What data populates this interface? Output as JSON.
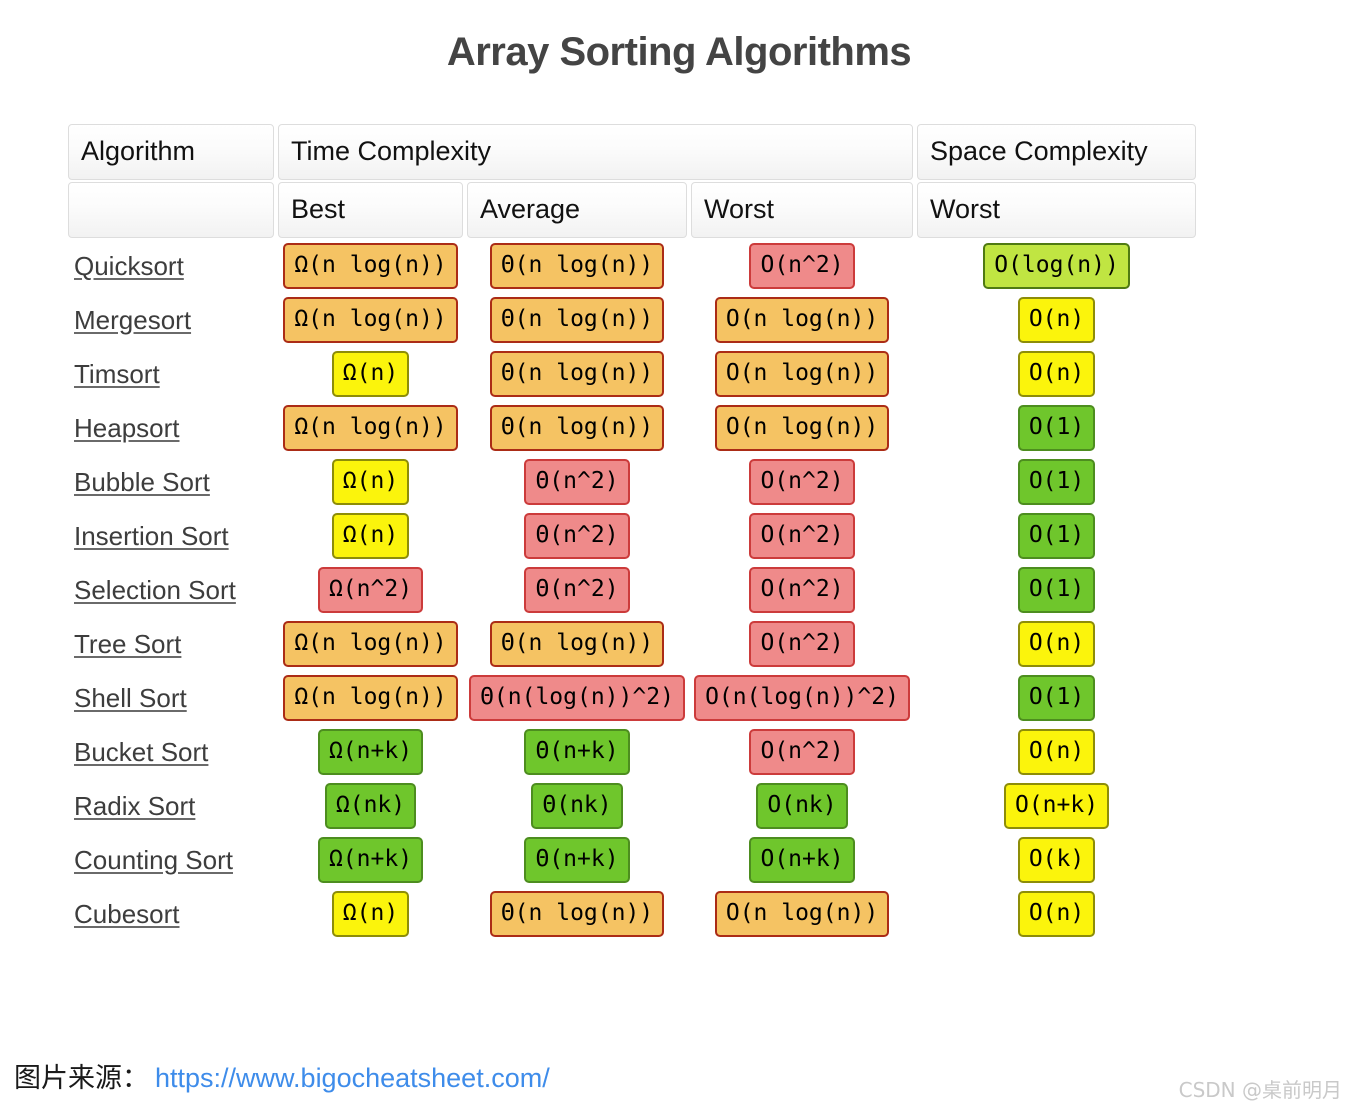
{
  "page": {
    "title": "Array Sorting Algorithms"
  },
  "table": {
    "group_headers": {
      "algorithm": "Algorithm",
      "time_complexity": "Time Complexity",
      "space_complexity": "Space Complexity"
    },
    "sub_headers": {
      "algorithm": "",
      "best": "Best",
      "average": "Average",
      "worst": "Worst",
      "space_worst": "Worst"
    },
    "rows": [
      {
        "name": "Quicksort",
        "best": "Ω(n log(n))",
        "best_color": "orange",
        "average": "Θ(n log(n))",
        "average_color": "orange",
        "worst": "O(n^2)",
        "worst_color": "red",
        "space": "O(log(n))",
        "space_color": "ygreen"
      },
      {
        "name": "Mergesort",
        "best": "Ω(n log(n))",
        "best_color": "orange",
        "average": "Θ(n log(n))",
        "average_color": "orange",
        "worst": "O(n log(n))",
        "worst_color": "orange",
        "space": "O(n)",
        "space_color": "yellow"
      },
      {
        "name": "Timsort",
        "best": "Ω(n)",
        "best_color": "yellow",
        "average": "Θ(n log(n))",
        "average_color": "orange",
        "worst": "O(n log(n))",
        "worst_color": "orange",
        "space": "O(n)",
        "space_color": "yellow"
      },
      {
        "name": "Heapsort",
        "best": "Ω(n log(n))",
        "best_color": "orange",
        "average": "Θ(n log(n))",
        "average_color": "orange",
        "worst": "O(n log(n))",
        "worst_color": "orange",
        "space": "O(1)",
        "space_color": "green"
      },
      {
        "name": "Bubble Sort",
        "best": "Ω(n)",
        "best_color": "yellow",
        "average": "Θ(n^2)",
        "average_color": "red",
        "worst": "O(n^2)",
        "worst_color": "red",
        "space": "O(1)",
        "space_color": "green"
      },
      {
        "name": "Insertion Sort",
        "best": "Ω(n)",
        "best_color": "yellow",
        "average": "Θ(n^2)",
        "average_color": "red",
        "worst": "O(n^2)",
        "worst_color": "red",
        "space": "O(1)",
        "space_color": "green"
      },
      {
        "name": "Selection Sort",
        "best": "Ω(n^2)",
        "best_color": "red",
        "average": "Θ(n^2)",
        "average_color": "red",
        "worst": "O(n^2)",
        "worst_color": "red",
        "space": "O(1)",
        "space_color": "green"
      },
      {
        "name": "Tree Sort",
        "best": "Ω(n log(n))",
        "best_color": "orange",
        "average": "Θ(n log(n))",
        "average_color": "orange",
        "worst": "O(n^2)",
        "worst_color": "red",
        "space": "O(n)",
        "space_color": "yellow"
      },
      {
        "name": "Shell Sort",
        "best": "Ω(n log(n))",
        "best_color": "orange",
        "average": "Θ(n(log(n))^2)",
        "average_color": "red",
        "worst": "O(n(log(n))^2)",
        "worst_color": "red",
        "space": "O(1)",
        "space_color": "green"
      },
      {
        "name": "Bucket Sort",
        "best": "Ω(n+k)",
        "best_color": "green",
        "average": "Θ(n+k)",
        "average_color": "green",
        "worst": "O(n^2)",
        "worst_color": "red",
        "space": "O(n)",
        "space_color": "yellow"
      },
      {
        "name": "Radix Sort",
        "best": "Ω(nk)",
        "best_color": "green",
        "average": "Θ(nk)",
        "average_color": "green",
        "worst": "O(nk)",
        "worst_color": "green",
        "space": "O(n+k)",
        "space_color": "yellow"
      },
      {
        "name": "Counting Sort",
        "best": "Ω(n+k)",
        "best_color": "green",
        "average": "Θ(n+k)",
        "average_color": "green",
        "worst": "O(n+k)",
        "worst_color": "green",
        "space": "O(k)",
        "space_color": "yellow"
      },
      {
        "name": "Cubesort",
        "best": "Ω(n)",
        "best_color": "yellow",
        "average": "Θ(n log(n))",
        "average_color": "orange",
        "worst": "O(n log(n))",
        "worst_color": "orange",
        "space": "O(n)",
        "space_color": "yellow"
      }
    ]
  },
  "footer": {
    "source_label": "图片来源：",
    "source_url": "https://www.bigocheatsheet.com/",
    "watermark": "CSDN @桌前明月"
  },
  "colors": {
    "orange_bg": "#f5c363",
    "orange_border": "#ab2c16",
    "red_bg": "#ef8a8a",
    "red_border": "#cc3b3b",
    "yellow_bg": "#fbf40c",
    "yellow_border": "#8d8d08",
    "green_bg": "#6fc62c",
    "green_border": "#4d8d1f",
    "yellow_green_bg": "#c0e542",
    "yellow_green_border": "#4f7a12",
    "title_color": "#444444",
    "link_color": "#3e8cea"
  }
}
